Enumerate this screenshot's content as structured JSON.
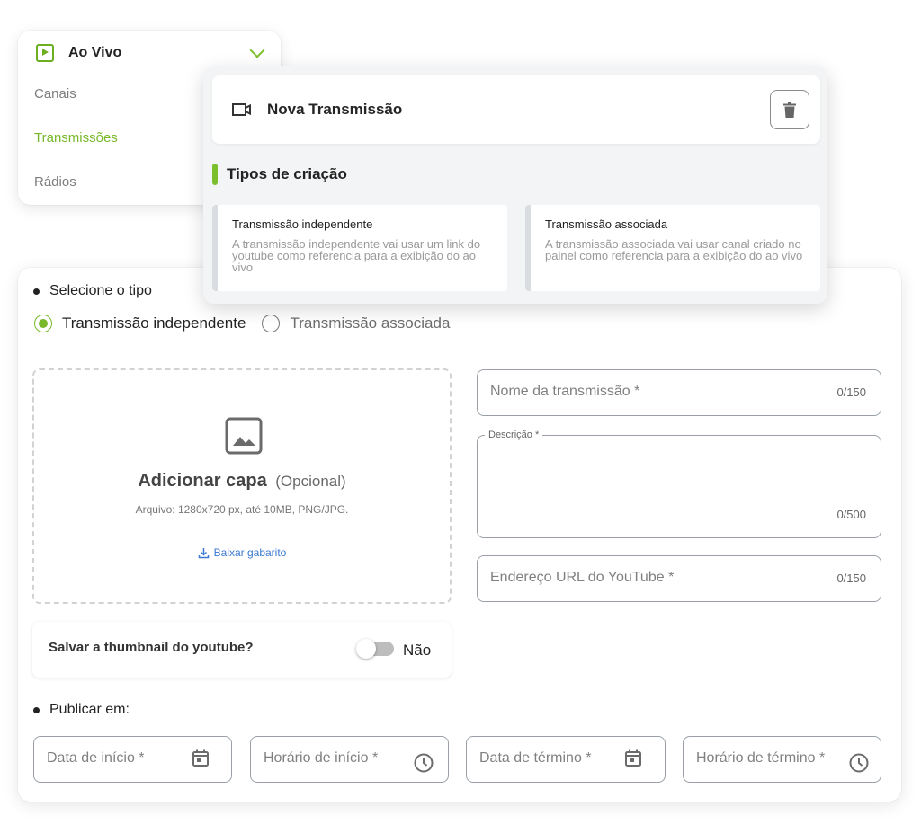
{
  "menu": {
    "title": "Ao Vivo",
    "items": [
      {
        "label": "Canais",
        "active": false
      },
      {
        "label": "Transmissões",
        "active": true
      },
      {
        "label": "Rádios",
        "active": false
      }
    ],
    "accent_color": "#7cbf2c"
  },
  "panel": {
    "title": "Nova Transmissão",
    "section_title": "Tipos de criação",
    "types": [
      {
        "title": "Transmissão independente",
        "description": "A transmissão independente vai usar um link do youtube como referencia para a exibição do ao vivo"
      },
      {
        "title": "Transmissão associada",
        "description": "A transmissão associada vai usar canal criado no painel como referencia para a exibição do ao vivo"
      }
    ]
  },
  "form": {
    "select_type_label": "Selecione o tipo",
    "radio_options": [
      {
        "label": "Transmissão independente",
        "checked": true
      },
      {
        "label": "Transmissão associada",
        "checked": false
      }
    ],
    "upload": {
      "title": "Adicionar capa",
      "optional": "(Opcional)",
      "info": "Arquivo: 1280x720 px, até 10MB, PNG/JPG.",
      "download_label": "Baixar gabarito"
    },
    "name_field": {
      "placeholder": "Nome da transmissão *",
      "counter": "0/150"
    },
    "description_field": {
      "legend": "Descrição *",
      "counter": "0/500"
    },
    "youtube_field": {
      "placeholder": "Endereço URL do YouTube *",
      "counter": "0/150"
    },
    "thumbnail": {
      "label": "Salvar a thumbnail do youtube?",
      "toggle_value": "Não",
      "enabled": false
    },
    "publish_label": "Publicar em:",
    "start_date": {
      "placeholder": "Data de início *"
    },
    "start_time": {
      "placeholder": "Horário de início *"
    },
    "end_date": {
      "placeholder": "Data de término *"
    },
    "end_time": {
      "placeholder": "Horário de término *"
    }
  }
}
